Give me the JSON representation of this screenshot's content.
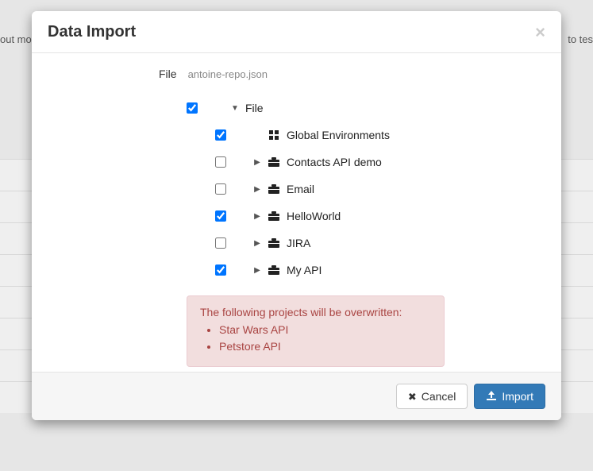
{
  "backdrop": {
    "left_snippet": "out mor",
    "right_snippet": "to tes"
  },
  "modal": {
    "title": "Data Import",
    "file_label": "File",
    "file_name": "antoine-repo.json",
    "tree": {
      "root": {
        "label": "File",
        "checked": true,
        "expanded": true
      },
      "children": [
        {
          "label": "Global Environments",
          "checked": true,
          "icon": "grid",
          "expandable": false
        },
        {
          "label": "Contacts API demo",
          "checked": false,
          "icon": "briefcase",
          "expandable": true
        },
        {
          "label": "Email",
          "checked": false,
          "icon": "briefcase",
          "expandable": true
        },
        {
          "label": "HelloWorld",
          "checked": true,
          "icon": "briefcase",
          "expandable": true
        },
        {
          "label": "JIRA",
          "checked": false,
          "icon": "briefcase",
          "expandable": true
        },
        {
          "label": "My API",
          "checked": true,
          "icon": "briefcase",
          "expandable": true
        }
      ]
    },
    "alert": {
      "message": "The following projects will be overwritten:",
      "items": [
        "Star Wars API",
        "Petstore API"
      ]
    },
    "buttons": {
      "cancel": "Cancel",
      "import": "Import"
    }
  }
}
